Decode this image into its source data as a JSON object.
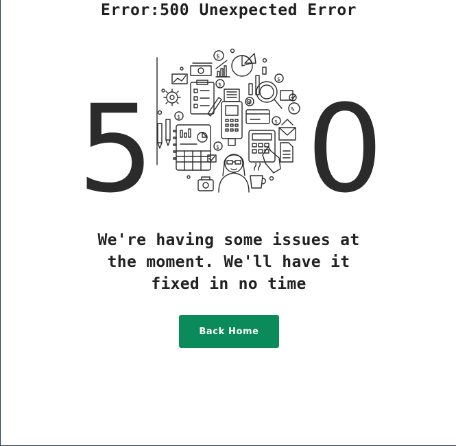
{
  "page": {
    "title": "Error:500 Unexpected Error",
    "code_left": "5",
    "code_right": "0",
    "message": "We're having some issues at the moment. We'll have it fixed in no time",
    "button_label": "Back Home",
    "accent_color": "#0b8a5a"
  },
  "illustration": {
    "icons": [
      "dollar-coin-icon",
      "banknote-icon",
      "bar-chart-icon",
      "pie-chart-icon",
      "clipboard-checklist-icon",
      "gear-icon",
      "calendar-icon",
      "pos-terminal-icon",
      "credit-card-icon",
      "magnifier-icon",
      "percent-icon",
      "envelope-icon",
      "calculator-icon",
      "document-icon",
      "wallet-icon",
      "coffee-cup-icon",
      "pen-icon",
      "pencil-icon",
      "woman-avatar-icon"
    ]
  }
}
